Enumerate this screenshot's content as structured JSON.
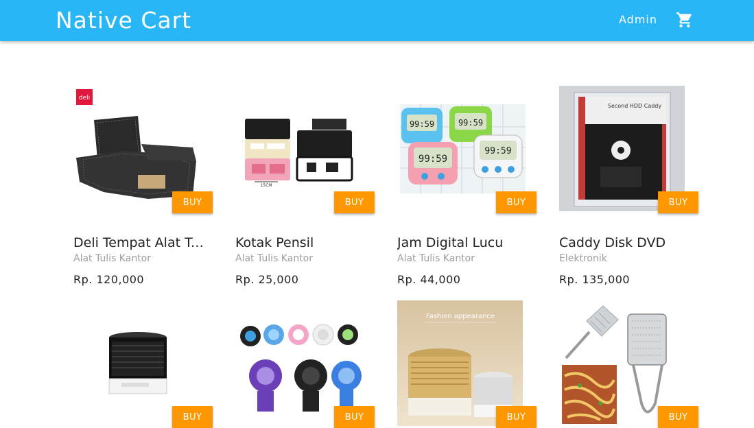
{
  "header": {
    "title": "Native Cart",
    "admin_label": "Admin",
    "cart_icon": "shopping-cart-icon"
  },
  "colors": {
    "appbar": "#29b6f6",
    "buy_button": "#ff9800"
  },
  "products": [
    {
      "name": "Deli Tempat Alat Tulis Kantor",
      "category": "Alat Tulis Kantor",
      "price": "Rp. 120,000",
      "buy_label": "BUY",
      "image": "mesh-desk-organizer",
      "logo_text": "deli"
    },
    {
      "name": "Kotak Pensil",
      "category": "Alat Tulis Kantor",
      "price": "Rp. 25,000",
      "buy_label": "BUY",
      "image": "pencil-box",
      "caption": "15CM"
    },
    {
      "name": "Jam Digital Lucu",
      "category": "Alat Tulis Kantor",
      "price": "Rp. 44,000",
      "buy_label": "BUY",
      "image": "digital-timers",
      "display": "99:59"
    },
    {
      "name": "Caddy Disk DVD",
      "category": "Elektronik",
      "price": "Rp. 135,000",
      "buy_label": "BUY",
      "image": "hdd-caddy",
      "label": "Second HDD Caddy"
    },
    {
      "buy_label": "BUY",
      "image": "bluetooth-speaker"
    },
    {
      "buy_label": "BUY",
      "image": "mini-fans"
    },
    {
      "buy_label": "BUY",
      "image": "gold-speaker",
      "banner": "Fashion appearance"
    },
    {
      "buy_label": "BUY",
      "image": "grater-and-noodles"
    }
  ]
}
